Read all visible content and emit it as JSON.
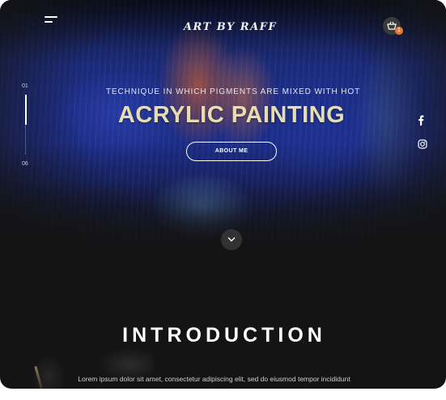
{
  "header": {
    "logo_text": "ART BY RAFF",
    "cart_count": "1"
  },
  "slider": {
    "current": "01",
    "total": "06",
    "progress": 0.5
  },
  "hero": {
    "subtitle": "TECHNIQUE IN WHICH PIGMENTS ARE MIXED WITH HOT",
    "title": "ACRYLIC PAINTING",
    "button_label": "ABOUT ME"
  },
  "social": {
    "icons": [
      "facebook-icon",
      "instagram-icon"
    ]
  },
  "intro": {
    "heading": "INTRODUCTION",
    "text": "Lorem ipsum dolor sit amet, consectetur adipiscing elit, sed do eiusmod tempor incididunt"
  },
  "colors": {
    "accent_gold": "#e7ddae",
    "badge_orange": "#e8792b",
    "background": "#141414"
  }
}
